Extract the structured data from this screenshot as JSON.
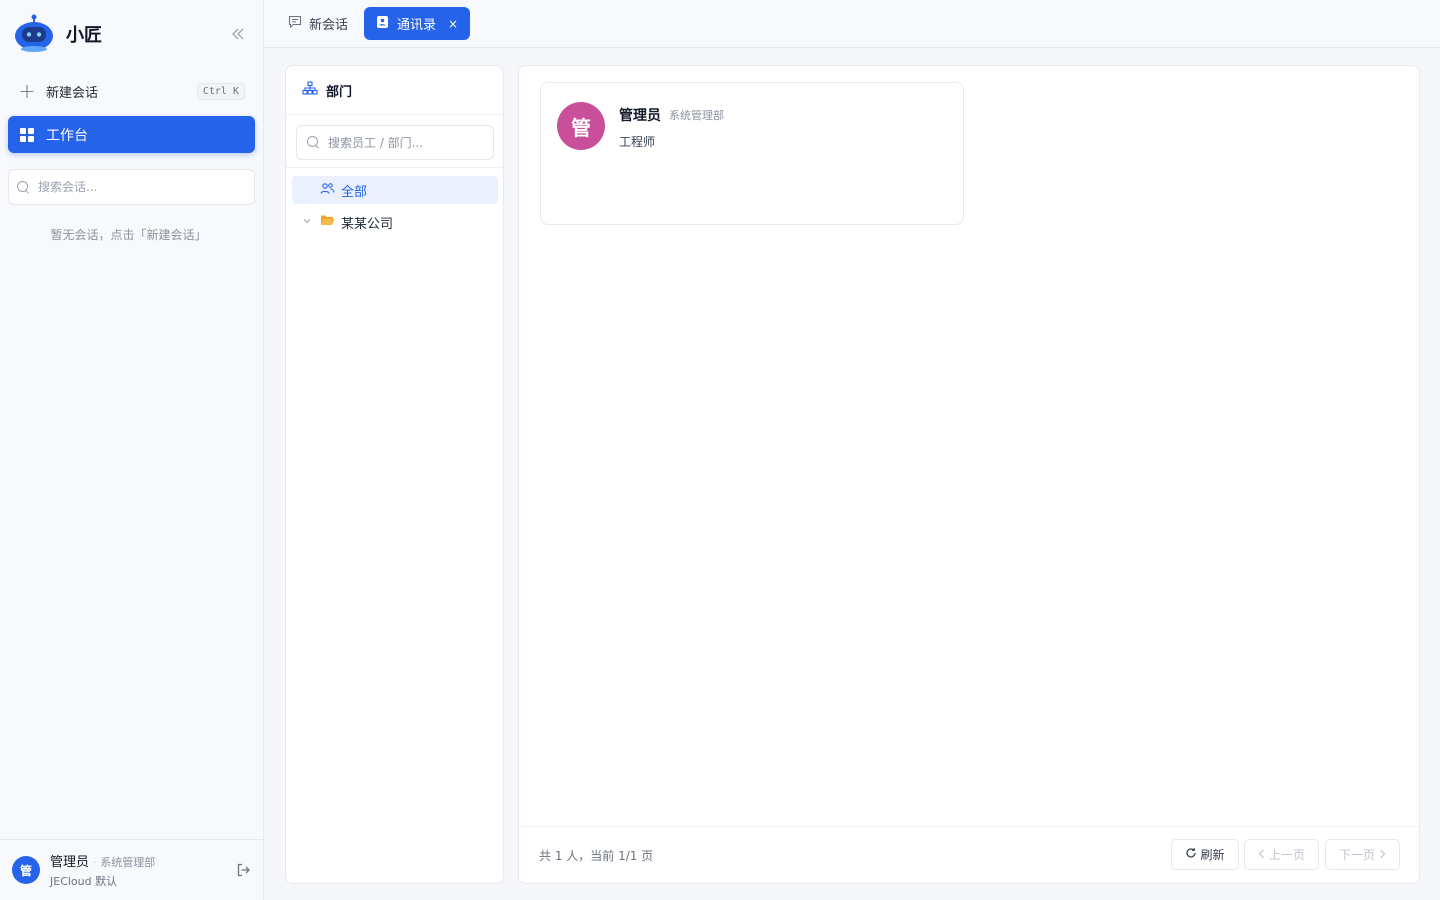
{
  "app": {
    "name": "小匠"
  },
  "sidebar": {
    "new_chat_label": "新建会话",
    "new_chat_shortcut": "Ctrl K",
    "workbench_label": "工作台",
    "search_placeholder": "搜索会话...",
    "empty_tip": "暂无会话，点击「新建会话」",
    "user": {
      "avatar_char": "管",
      "name": "管理员",
      "dept": "系统管理部",
      "org_line": "JECloud 默认"
    }
  },
  "tabs": [
    {
      "label": "新会话",
      "icon": "chat-bubble-icon",
      "active": false
    },
    {
      "label": "通讯录",
      "icon": "contacts-icon",
      "active": true,
      "close": "×"
    }
  ],
  "department_panel": {
    "title": "部门",
    "search_placeholder": "搜索员工 / 部门...",
    "tree": [
      {
        "label": "全部",
        "icon": "people-icon",
        "selected": true
      },
      {
        "label": "某某公司",
        "icon": "folder-open-icon",
        "expanded": false
      }
    ]
  },
  "contacts": [
    {
      "avatar_char": "管",
      "avatar_color": "#c94f9a",
      "name": "管理员",
      "dept": "系统管理部",
      "title": "工程师"
    }
  ],
  "footer": {
    "summary": "共 1 人，当前 1/1 页",
    "refresh_label": "刷新",
    "prev_label": "上一页",
    "next_label": "下一页"
  },
  "colors": {
    "accent": "#2563eb",
    "folder": "#f5a623"
  }
}
